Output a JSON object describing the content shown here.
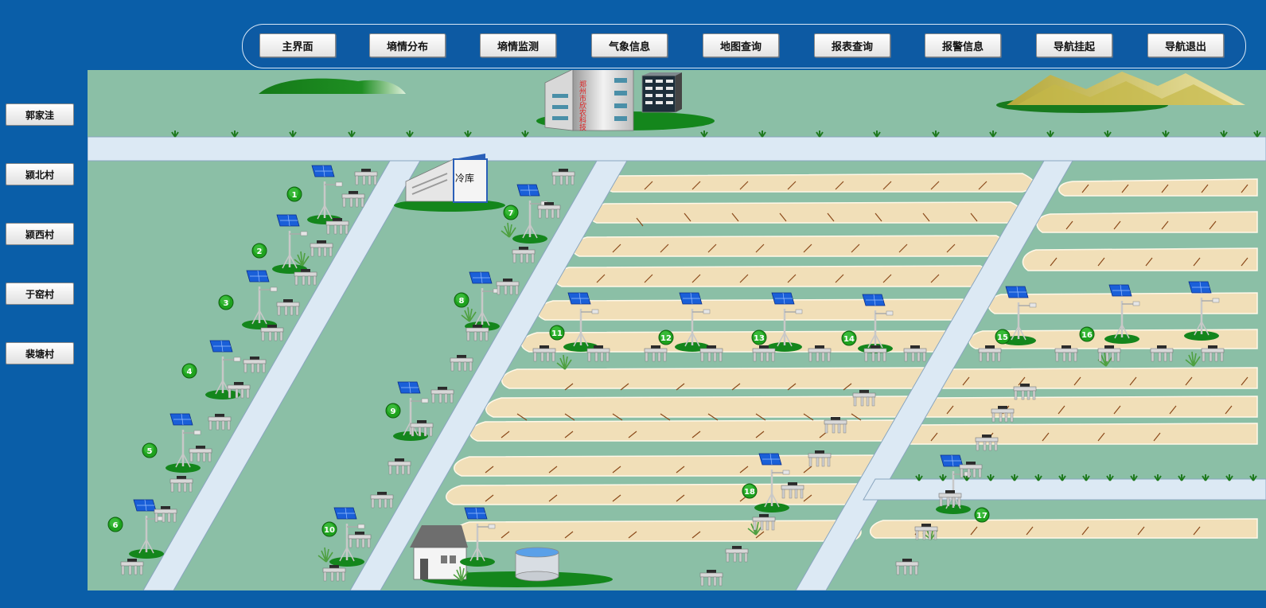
{
  "navigation": {
    "items": [
      "主界面",
      "墒情分布",
      "墒情监测",
      "气象信息",
      "地图查询",
      "报表查询",
      "报警信息",
      "导航挂起",
      "导航退出"
    ]
  },
  "villages": {
    "items": [
      "郭家洼",
      "颍北村",
      "颍西村",
      "于窑村",
      "裴塘村"
    ]
  },
  "scene": {
    "building_sign": "郑州市欣农科技",
    "cold_storage_label": "冷库",
    "stations": [
      "1",
      "2",
      "3",
      "4",
      "5",
      "6",
      "7",
      "8",
      "9",
      "10",
      "11",
      "12",
      "13",
      "14",
      "15",
      "16",
      "17",
      "18"
    ]
  },
  "colors": {
    "frame_blue": "#0a5ea8",
    "field_green": "#8bbfa6",
    "road": "#dce9f4",
    "furrow": "#f1dfb8",
    "marker_green": "#1e9e1e"
  }
}
